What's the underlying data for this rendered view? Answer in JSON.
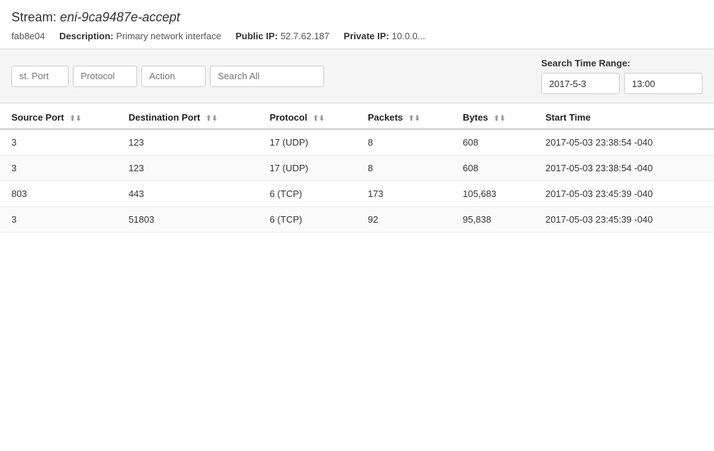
{
  "header": {
    "stream_label": "Stream:",
    "stream_name": "eni-9ca9487e-accept",
    "eni_id": "fab8e04",
    "description_label": "Description:",
    "description_value": "Primary network interface",
    "public_ip_label": "Public IP:",
    "public_ip_value": "52.7.62.187",
    "private_ip_label": "Private IP:",
    "private_ip_value": "10.0.0..."
  },
  "toolbar": {
    "filters": {
      "dst_port_placeholder": "st. Port",
      "protocol_placeholder": "Protocol",
      "action_placeholder": "Action",
      "search_all_placeholder": "Search All"
    },
    "time_range": {
      "label": "Search Time Range:",
      "date_value": "2017-5-3",
      "time_value": "13:00"
    }
  },
  "table": {
    "columns": [
      {
        "id": "source_port",
        "label": "Source Port",
        "sortable": true
      },
      {
        "id": "dest_port",
        "label": "Destination Port",
        "sortable": true
      },
      {
        "id": "protocol",
        "label": "Protocol",
        "sortable": true
      },
      {
        "id": "packets",
        "label": "Packets",
        "sortable": true
      },
      {
        "id": "bytes",
        "label": "Bytes",
        "sortable": true
      },
      {
        "id": "start_time",
        "label": "Start Time",
        "sortable": false
      }
    ],
    "rows": [
      {
        "source_port": "3",
        "dest_port": "123",
        "protocol": "17 (UDP)",
        "packets": "8",
        "bytes": "608",
        "start_time": "2017-05-03 23:38:54 -040"
      },
      {
        "source_port": "3",
        "dest_port": "123",
        "protocol": "17 (UDP)",
        "packets": "8",
        "bytes": "608",
        "start_time": "2017-05-03 23:38:54 -040"
      },
      {
        "source_port": "803",
        "dest_port": "443",
        "protocol": "6 (TCP)",
        "packets": "173",
        "bytes": "105,683",
        "start_time": "2017-05-03 23:45:39 -040"
      },
      {
        "source_port": "3",
        "dest_port": "51803",
        "protocol": "6 (TCP)",
        "packets": "92",
        "bytes": "95,838",
        "start_time": "2017-05-03 23:45:39 -040"
      }
    ]
  }
}
